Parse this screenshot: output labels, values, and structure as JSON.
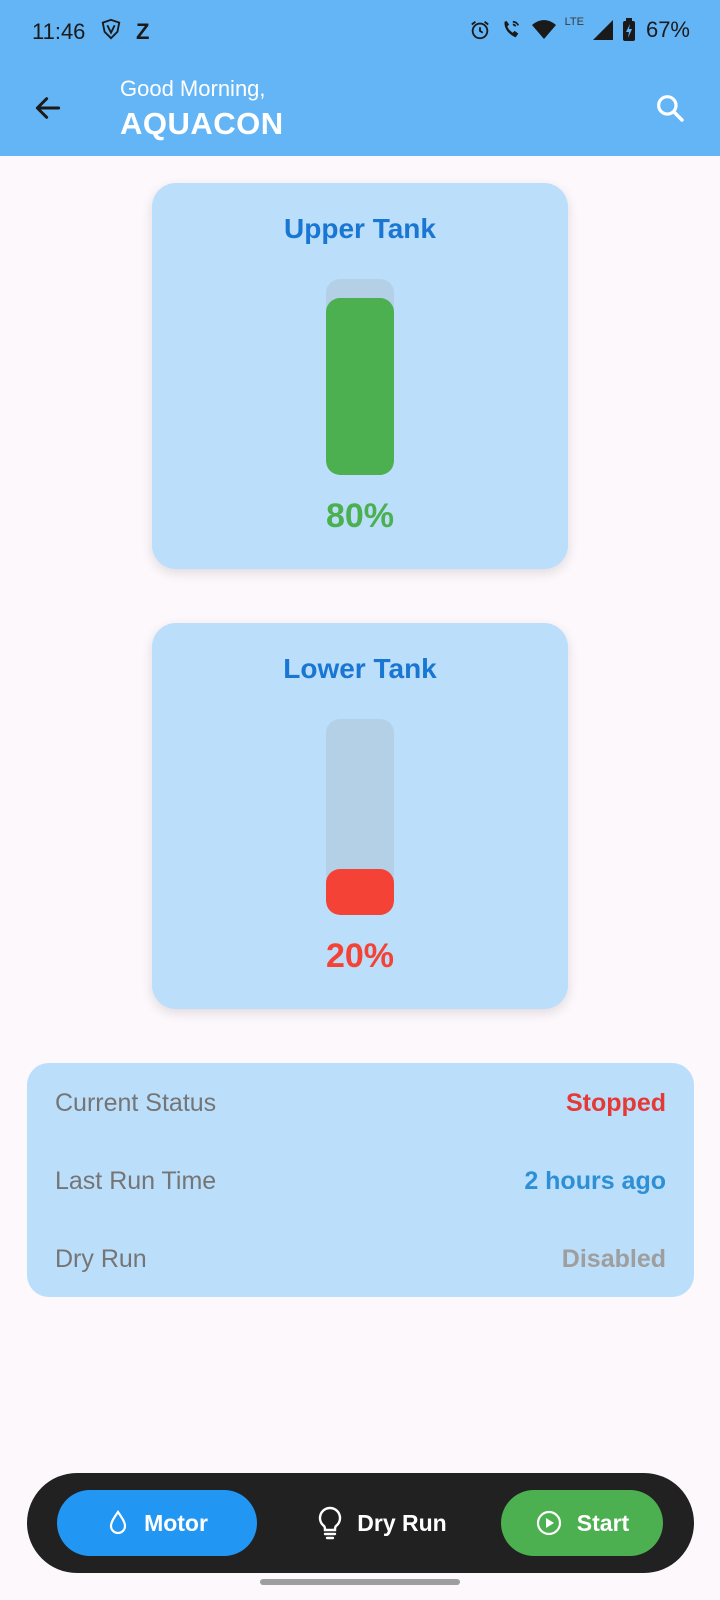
{
  "status_bar": {
    "time": "11:46",
    "left_icons": [
      "vpn-shield-icon",
      "z-icon"
    ],
    "z_text": "Z",
    "lte_text": "LTE",
    "battery": "67%",
    "right_icons": [
      "alarm-icon",
      "wifi-call-icon",
      "wifi-icon",
      "signal-icon",
      "battery-charging-icon"
    ]
  },
  "app_bar": {
    "greeting": "Good Morning,",
    "app_name": "AQUACON",
    "back_icon": "arrow-back-icon",
    "search_icon": "search-icon"
  },
  "tanks": {
    "upper": {
      "title": "Upper Tank",
      "percent_text": "80%",
      "level": 0.8,
      "color": "#4caf50"
    },
    "lower": {
      "title": "Lower Tank",
      "percent_text": "20%",
      "level": 0.2,
      "color": "#f44336"
    }
  },
  "status": {
    "rows": [
      {
        "label": "Current Status",
        "value": "Stopped",
        "color": "#e53935"
      },
      {
        "label": "Last Run Time",
        "value": "2 hours ago",
        "color": "#2d8fd6"
      },
      {
        "label": "Dry Run",
        "value": "Disabled",
        "color": "#9e9e9e"
      }
    ]
  },
  "bottom_nav": {
    "motor": {
      "label": "Motor",
      "icon": "water-drop-icon",
      "color": "#2196f3"
    },
    "dry_run": {
      "label": "Dry Run",
      "icon": "lightbulb-icon"
    },
    "start": {
      "label": "Start",
      "icon": "play-circle-icon",
      "color": "#4caf50"
    }
  },
  "colors": {
    "app_bar": "#64b5f6",
    "card": "#bbdefb",
    "title_blue": "#1976d2",
    "nav_bg": "#212121"
  }
}
